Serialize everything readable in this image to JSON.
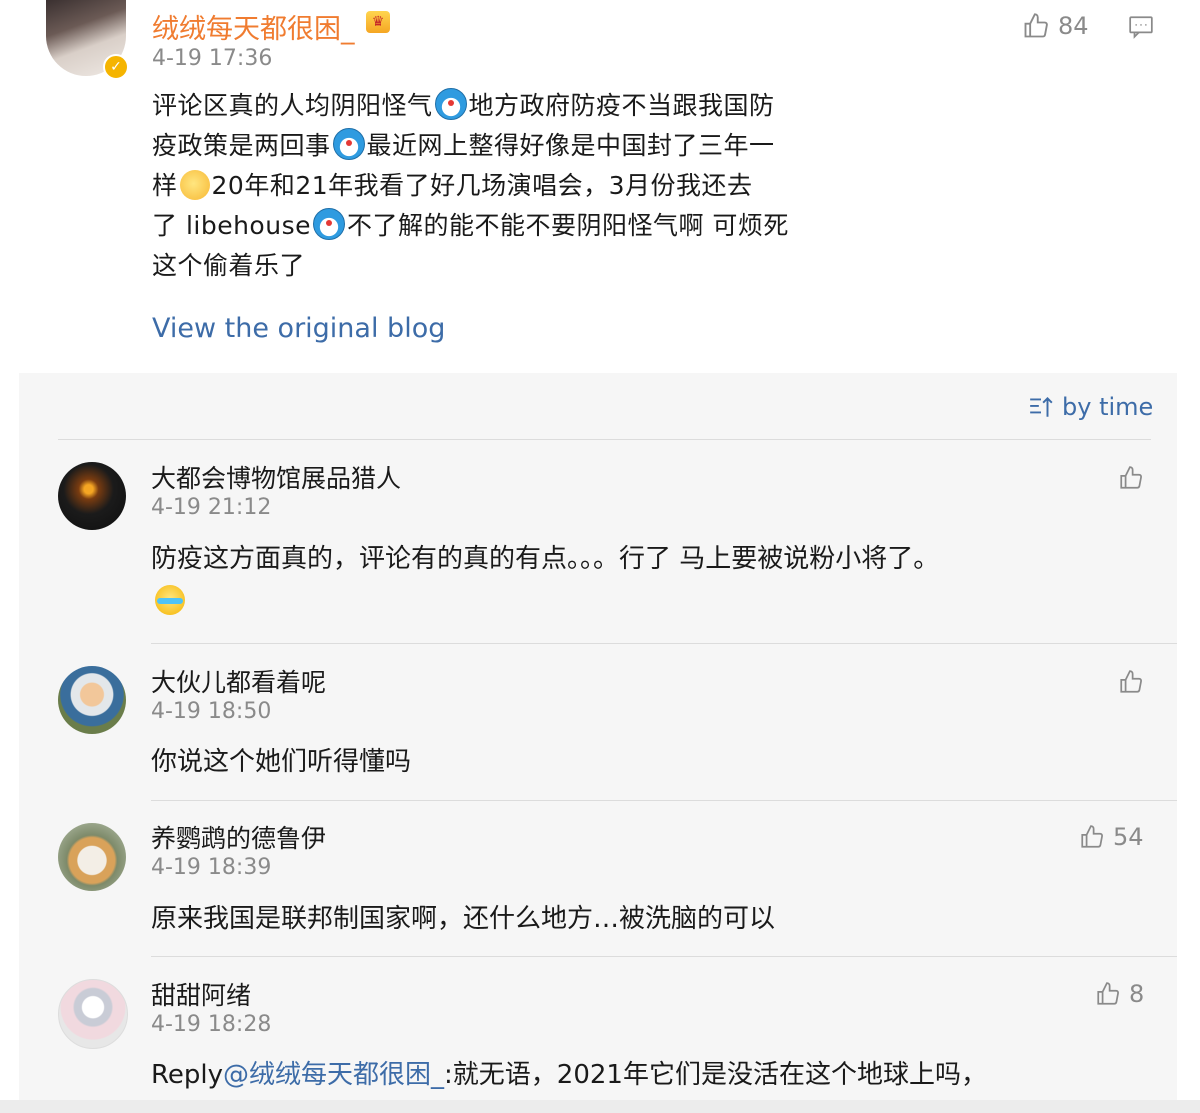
{
  "post": {
    "author": "绒绒每天都很困_",
    "time": "4-19 17:36",
    "likes": "84",
    "text_line1a": "评论区真的人均阴阳怪气",
    "text_line1b": "地方政府防疫不当跟我国防",
    "text_line2a": "疫政策是两回事",
    "text_line2b": "最近网上整得好像是中国封了三年一",
    "text_line3a": "样",
    "text_line3b": "20年和21年我看了好几场演唱会，3月份我还去",
    "text_line4a": "了 libehouse",
    "text_line4b": "不了解的能不能不要阴阳怪气啊 可烦死",
    "text_line5": "这个偷着乐了",
    "view_original": "View the original blog"
  },
  "sort": {
    "label": "by time"
  },
  "comments": [
    {
      "name": "大都会博物馆展品猎人",
      "time": "4-19 21:12",
      "text": "防疫这方面真的，评论有的真的有点。。。行了 马上要被说粉小将了。",
      "likes": ""
    },
    {
      "name": "大伙儿都看着呢",
      "time": "4-19 18:50",
      "text": "你说这个她们听得懂吗",
      "likes": ""
    },
    {
      "name": "养鹦鹉的德鲁伊",
      "time": "4-19 18:39",
      "text": "原来我国是联邦制国家啊，还什么地方…被洗脑的可以",
      "likes": "54"
    },
    {
      "name": "甜甜阿绪",
      "time": "4-19 18:28",
      "reply_prefix": "Reply",
      "reply_mention": "@绒绒每天都很困_",
      "text": ":就无语，2021年它们是没活在这个地球上吗，",
      "likes": "8"
    }
  ],
  "icons": {
    "like": "thumbs-up-icon",
    "comment": "comment-icon",
    "sort": "sort-icon",
    "verified": "verified-badge-icon",
    "crown": "crown-icon"
  },
  "colors": {
    "author_name": "#f07c30",
    "link": "#3d6ca8",
    "panel_bg": "#f6f6f6",
    "muted": "#8a8a8a"
  }
}
